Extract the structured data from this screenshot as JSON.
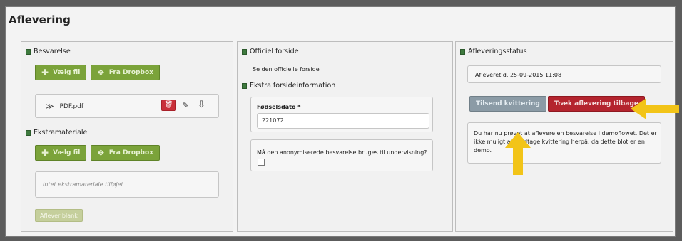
{
  "page": {
    "title": "Aflevering"
  },
  "besvarelse": {
    "heading": "Besvarelse",
    "choose_file": "Vælg fil",
    "dropbox": "Fra Dropbox",
    "file_name": "PDF.pdf"
  },
  "ekstra": {
    "heading": "Ekstramateriale",
    "choose_file": "Vælg fil",
    "dropbox": "Fra Dropbox",
    "empty_text": "Intet ekstramateriale tilføjet",
    "submit_label": "Aflever blank"
  },
  "forside": {
    "heading": "Officiel forside",
    "link": "Se den officielle forside",
    "extra_heading": "Ekstra forsideinformation",
    "dob_label": "Fødselsdato *",
    "dob_value": "221072",
    "anon_question": "Må den anonymiserede besvarelse bruges til undervisning?"
  },
  "status": {
    "heading": "Afleveringsstatus",
    "submitted": "Afleveret d. 25-09-2015 11:08",
    "resend_receipt": "Tilsend kvittering",
    "withdraw": "Træk aflevering tilbage",
    "info": "Du har nu prøvet at aflevere en besvarelse i demoflowet. Det er ikke muligt at modtage kvittering herpå, da dette blot er en demo."
  },
  "colors": {
    "green": "#7ba33a",
    "red": "#b4242e",
    "gray": "#8b9ba6",
    "arrow": "#f2c418"
  }
}
